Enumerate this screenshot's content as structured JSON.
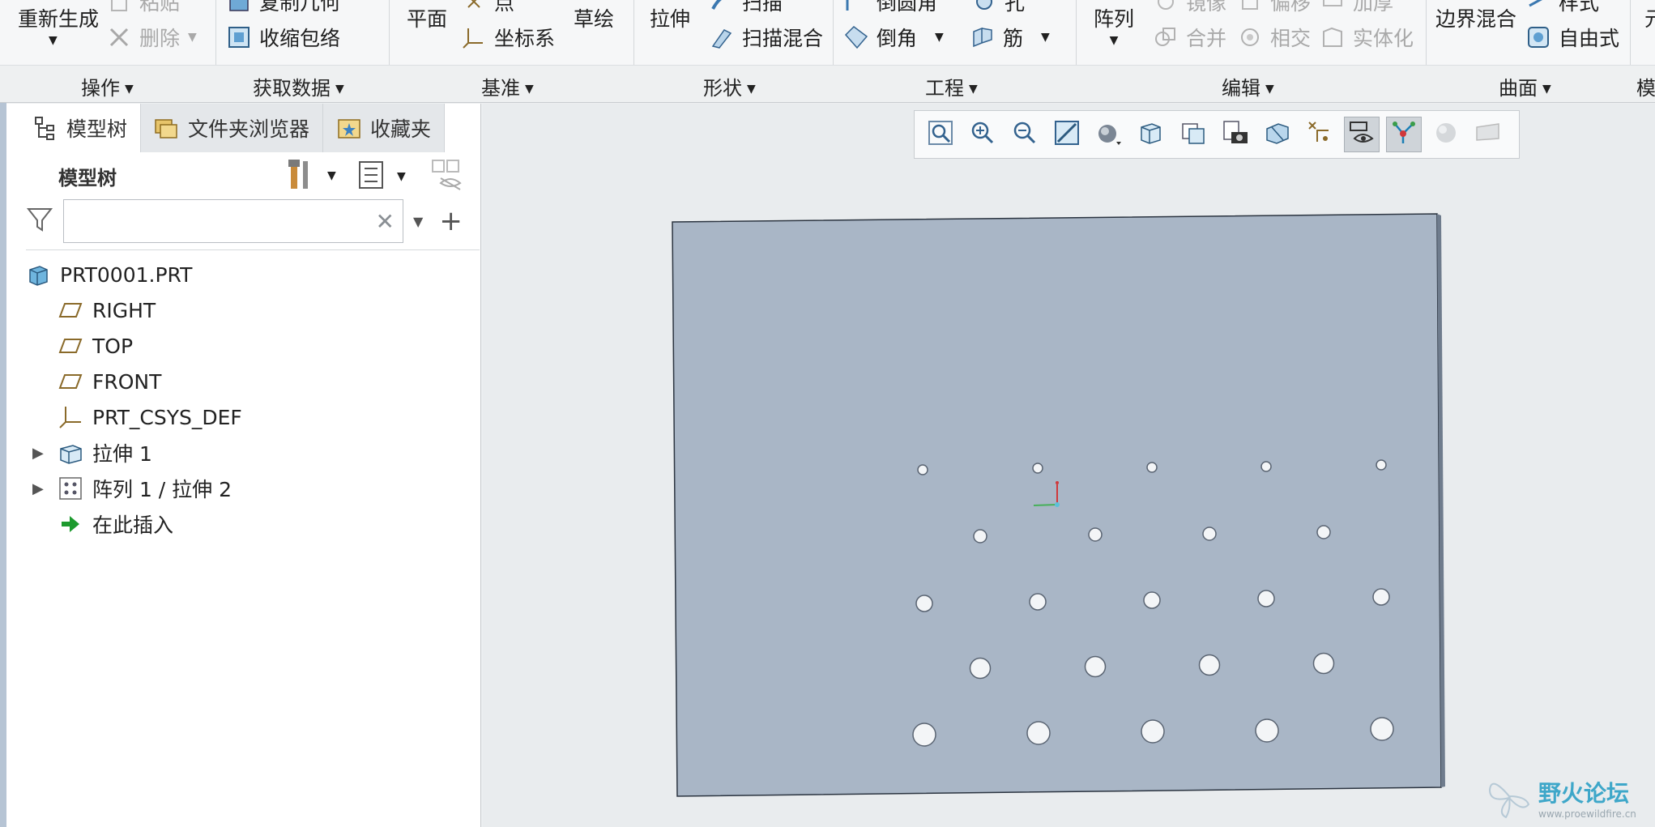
{
  "ribbon": {
    "cmds": {
      "regenerate": "重新生成",
      "paste_cut": "粘贴",
      "delete": "删除",
      "copy_geom_cut": "复制几何",
      "shrinkwrap": "收缩包络",
      "plane": "平面",
      "point_cut": "点",
      "csys": "坐标系",
      "sketch": "草绘",
      "extrude": "拉伸",
      "sweep_cut": "扫描",
      "swept_blend": "扫描混合",
      "round_cut": "倒圆角",
      "hole_cut": "孔",
      "chamfer": "倒角",
      "rib": "筋",
      "pattern": "阵列",
      "mirror_cut": "镜像",
      "offset_cut": "偏移",
      "thicken_cut": "加厚",
      "merge": "合并",
      "intersect": "相交",
      "solidify": "实体化",
      "boundary_blend": "边界混合",
      "style_cut": "样式",
      "freestyle": "自由式",
      "next_cut": "元"
    },
    "groups": {
      "operations": "操作",
      "get_data": "获取数据",
      "datum": "基准",
      "shapes": "形状",
      "engineering": "工程",
      "editing": "编辑",
      "surfaces": "曲面",
      "model_cut": "模"
    }
  },
  "sidebar": {
    "tabs": [
      "模型树",
      "文件夹浏览器",
      "收藏夹"
    ],
    "tree_title": "模型树",
    "search_placeholder": "",
    "tree": {
      "root": "PRT0001.PRT",
      "right": "RIGHT",
      "top": "TOP",
      "front": "FRONT",
      "csys": "PRT_CSYS_DEF",
      "extrude1": "拉伸 1",
      "pattern": "阵列 1 / 拉伸 2",
      "insert": "在此插入"
    }
  },
  "watermark": {
    "text": "野火论坛",
    "url": "www.proewildfire.cn"
  },
  "colors": {
    "part_face": "#a9b6c6",
    "viewport_bg": "#e9ecee",
    "ribbon_bg": "#f6f7f8"
  }
}
